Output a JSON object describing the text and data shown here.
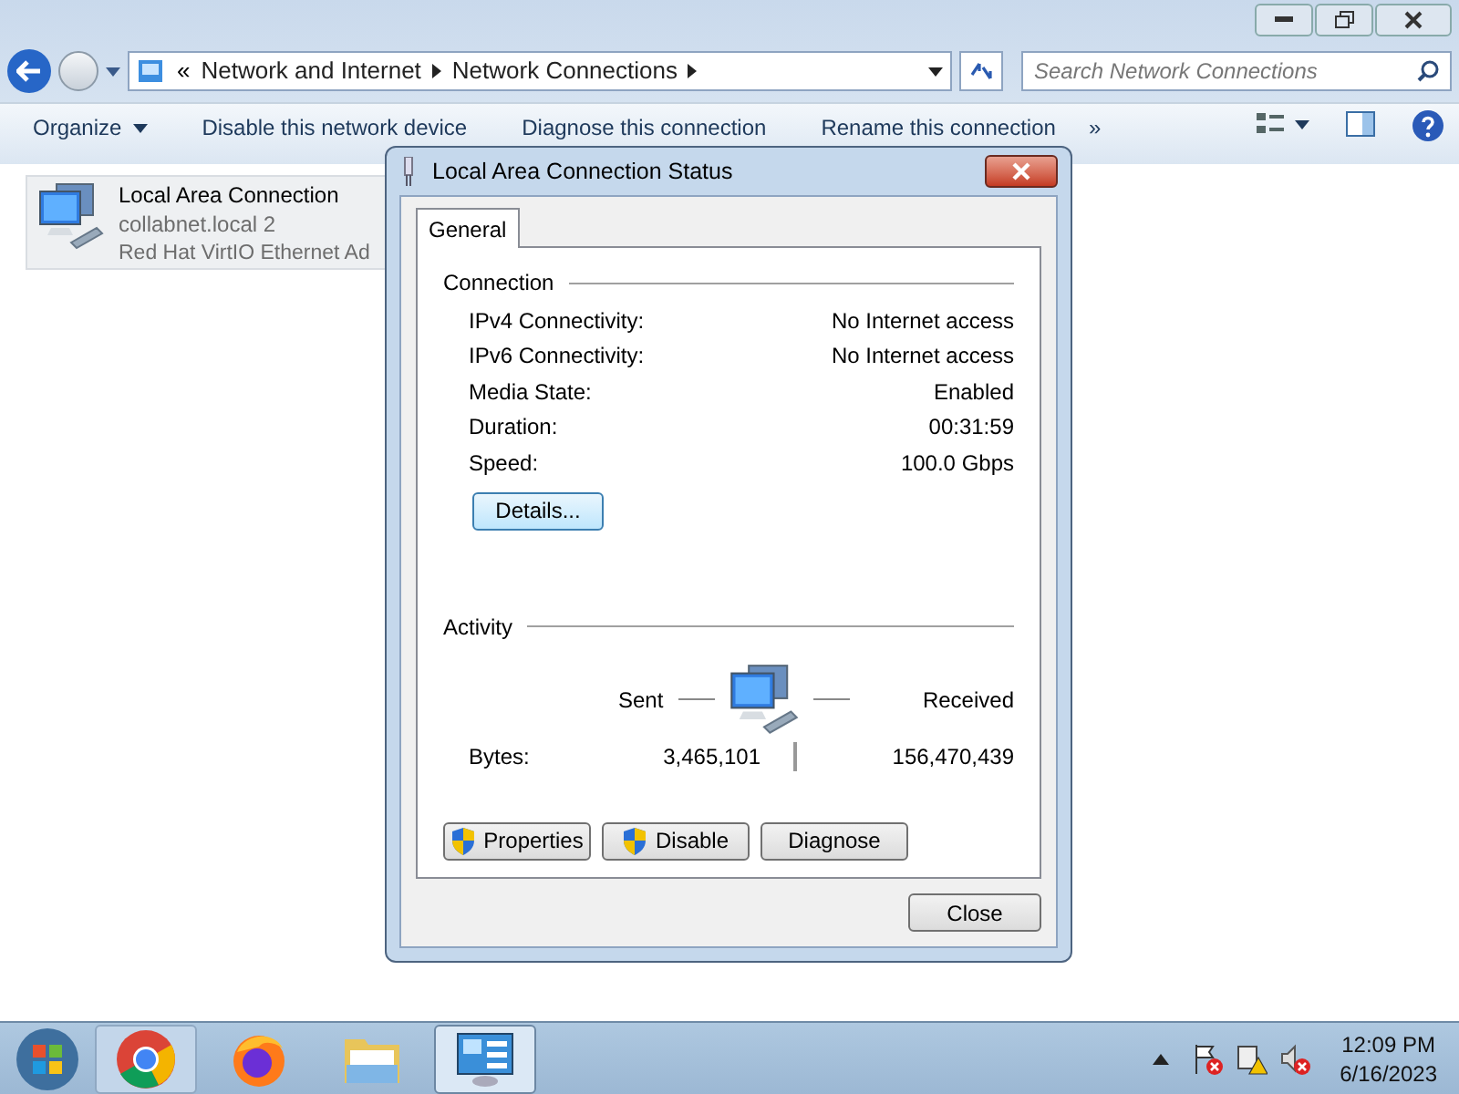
{
  "breadcrumb": {
    "prefix": "«",
    "items": [
      "Network and Internet",
      "Network Connections"
    ]
  },
  "search": {
    "placeholder": "Search Network Connections"
  },
  "toolbar": {
    "organize": "Organize",
    "commands": [
      "Disable this network device",
      "Diagnose this connection",
      "Rename this connection"
    ],
    "more": "»"
  },
  "connection": {
    "name": "Local Area Connection",
    "network": "collabnet.local  2",
    "adapter": "Red Hat VirtIO Ethernet Ad",
    "selected": true
  },
  "dialog": {
    "title": "Local Area Connection Status",
    "tabs": [
      {
        "label": "General",
        "selected": true
      }
    ],
    "connection_heading": "Connection",
    "fields": [
      {
        "label": "IPv4 Connectivity:",
        "value": "No Internet access"
      },
      {
        "label": "IPv6 Connectivity:",
        "value": "No Internet access"
      },
      {
        "label": "Media State:",
        "value": "Enabled"
      },
      {
        "label": "Duration:",
        "value": "00:31:59"
      },
      {
        "label": "Speed:",
        "value": "100.0 Gbps"
      }
    ],
    "details_button": "Details...",
    "activity_heading": "Activity",
    "sent_label": "Sent",
    "received_label": "Received",
    "bytes": {
      "label": "Bytes:",
      "sent": "3,465,101",
      "received": "156,470,439"
    },
    "buttons": [
      {
        "label": "Properties",
        "shield": true
      },
      {
        "label": "Disable",
        "shield": true
      },
      {
        "label": "Diagnose",
        "shield": false
      }
    ],
    "close_button": "Close"
  },
  "taskbar": {
    "apps": [
      {
        "kind": "chrome",
        "selected": false
      },
      {
        "kind": "firefox",
        "selected": false
      },
      {
        "kind": "explorer",
        "selected": false
      },
      {
        "kind": "control",
        "selected": true
      }
    ],
    "clock": {
      "time": "12:09 PM",
      "date": "6/16/2023"
    }
  }
}
